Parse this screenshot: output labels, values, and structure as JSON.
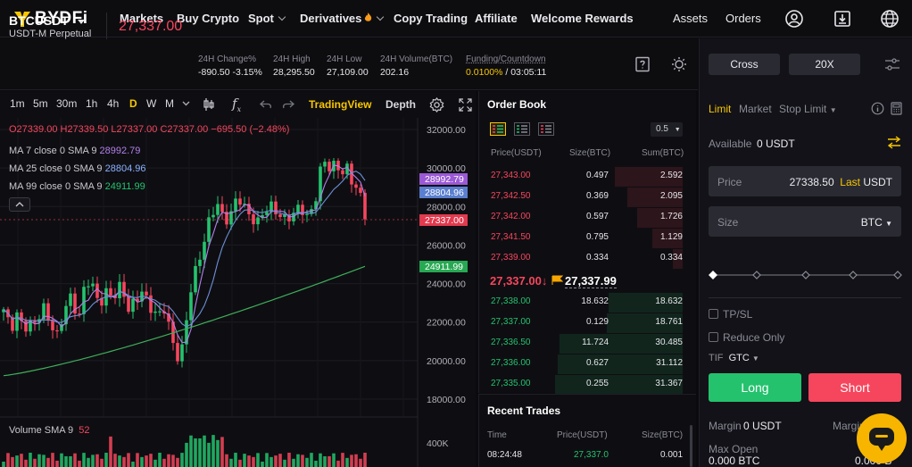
{
  "nav": {
    "logo_text": "BYDFi",
    "items": [
      {
        "label": "Markets"
      },
      {
        "label": "Buy Crypto"
      },
      {
        "label": "Spot"
      },
      {
        "label": "Derivatives"
      },
      {
        "label": "Copy Trading"
      },
      {
        "label": "Affiliate"
      },
      {
        "label": "Welcome Rewards"
      }
    ],
    "assets": "Assets",
    "orders": "Orders",
    "icons": [
      "user-icon",
      "download-icon",
      "globe-icon"
    ]
  },
  "ticker": {
    "symbol": "BTCUSDT",
    "subtitle": "USDT-M Perpetual",
    "last_price": "27,337.00",
    "change_label": "24H Change%",
    "change_value": "-890.50 -3.15%",
    "high_label": "24H High",
    "high_value": "28,295.50",
    "low_label": "24H Low",
    "low_value": "27,109.00",
    "volume_label": "24H Volume(BTC)",
    "volume_value": "202.16",
    "funding_label": "Funding/Countdown",
    "funding_rate": "0.0100%",
    "countdown": "03:05:11"
  },
  "chart_toolbar": {
    "timeframes": [
      "1m",
      "5m",
      "30m",
      "1h",
      "4h",
      "D",
      "W",
      "M"
    ],
    "active_timeframe": "D",
    "tradingview": "TradingView",
    "depth": "Depth"
  },
  "chart_legend": {
    "ohlc_o": "O27339.00",
    "ohlc_h": "H27339.50",
    "ohlc_l": "L27337.00",
    "ohlc_c": "C27337.00",
    "ohlc_chg": "−695.50 (−2.48%)",
    "ma7_label": "MA 7 close 0 SMA 9",
    "ma7_value": "28992.79",
    "ma25_label": "MA 25 close 0 SMA 9",
    "ma25_value": "28804.96",
    "ma99_label": "MA 99 close 0 SMA 9",
    "ma99_value": "24911.99",
    "volume_label": "Volume SMA 9",
    "volume_value": "52"
  },
  "chart_data": {
    "type": "candlestick",
    "y_ticks": [
      "32000.00",
      "30000.00",
      "28000.00",
      "26000.00",
      "24000.00",
      "22000.00",
      "20000.00",
      "18000.00"
    ],
    "ylim": [
      18000,
      32000
    ],
    "volume_tick": "400K",
    "price_tags": {
      "ma7": "28992.79",
      "ma25": "28804.96",
      "last": "27337.00",
      "ma99": "24911.99"
    },
    "colors": {
      "up": "#25c26e",
      "down": "#f6465d",
      "ma7": "#b37feb",
      "ma25": "#6d8fd6",
      "ma99": "#3fae5a"
    }
  },
  "orderbook": {
    "title": "Order Book",
    "step": "0.5",
    "headers": {
      "price": "Price(USDT)",
      "size": "Size(BTC)",
      "sum": "Sum(BTC)"
    },
    "asks": [
      {
        "price": "27,343.00",
        "size": "0.497",
        "sum": "2.592",
        "depth": 0.33
      },
      {
        "price": "27,342.50",
        "size": "0.369",
        "sum": "2.095",
        "depth": 0.27
      },
      {
        "price": "27,342.00",
        "size": "0.597",
        "sum": "1.726",
        "depth": 0.22
      },
      {
        "price": "27,341.50",
        "size": "0.795",
        "sum": "1.129",
        "depth": 0.15
      },
      {
        "price": "27,339.00",
        "size": "0.334",
        "sum": "0.334",
        "depth": 0.05
      }
    ],
    "mid_price": "27,337.00↓",
    "mark_price": "27,337.99",
    "bids": [
      {
        "price": "27,338.00",
        "size": "18.632",
        "sum": "18.632",
        "depth": 0.36
      },
      {
        "price": "27,337.00",
        "size": "0.129",
        "sum": "18.761",
        "depth": 0.37
      },
      {
        "price": "27,336.50",
        "size": "11.724",
        "sum": "30.485",
        "depth": 0.6
      },
      {
        "price": "27,336.00",
        "size": "0.627",
        "sum": "31.112",
        "depth": 0.61
      },
      {
        "price": "27,335.00",
        "size": "0.255",
        "sum": "31.367",
        "depth": 0.62
      }
    ]
  },
  "recent_trades": {
    "title": "Recent Trades",
    "headers": {
      "time": "Time",
      "price": "Price(USDT)",
      "size": "Size(BTC)"
    },
    "rows": [
      {
        "time": "08:24:48",
        "price": "27,337.0",
        "size": "0.001"
      }
    ]
  },
  "order_panel": {
    "margin_mode": "Cross",
    "leverage": "20X",
    "tabs": {
      "limit": "Limit",
      "market": "Market",
      "stop_limit": "Stop Limit"
    },
    "available_label": "Available",
    "available_value": "0 USDT",
    "price_label": "Price",
    "price_value": "27338.50",
    "price_last": "Last",
    "price_unit": "USDT",
    "size_label": "Size",
    "size_unit": "BTC",
    "tp_sl": "TP/SL",
    "reduce_only": "Reduce Only",
    "tif_label": "TIF",
    "tif_value": "GTC",
    "long": "Long",
    "short": "Short",
    "margin_label": "Margin",
    "margin_value": "0 USDT",
    "margin_right": "Margin",
    "max_open_label": "Max Open",
    "max_open_value": "0.000 BTC",
    "max_open_right": "0.000 B"
  }
}
